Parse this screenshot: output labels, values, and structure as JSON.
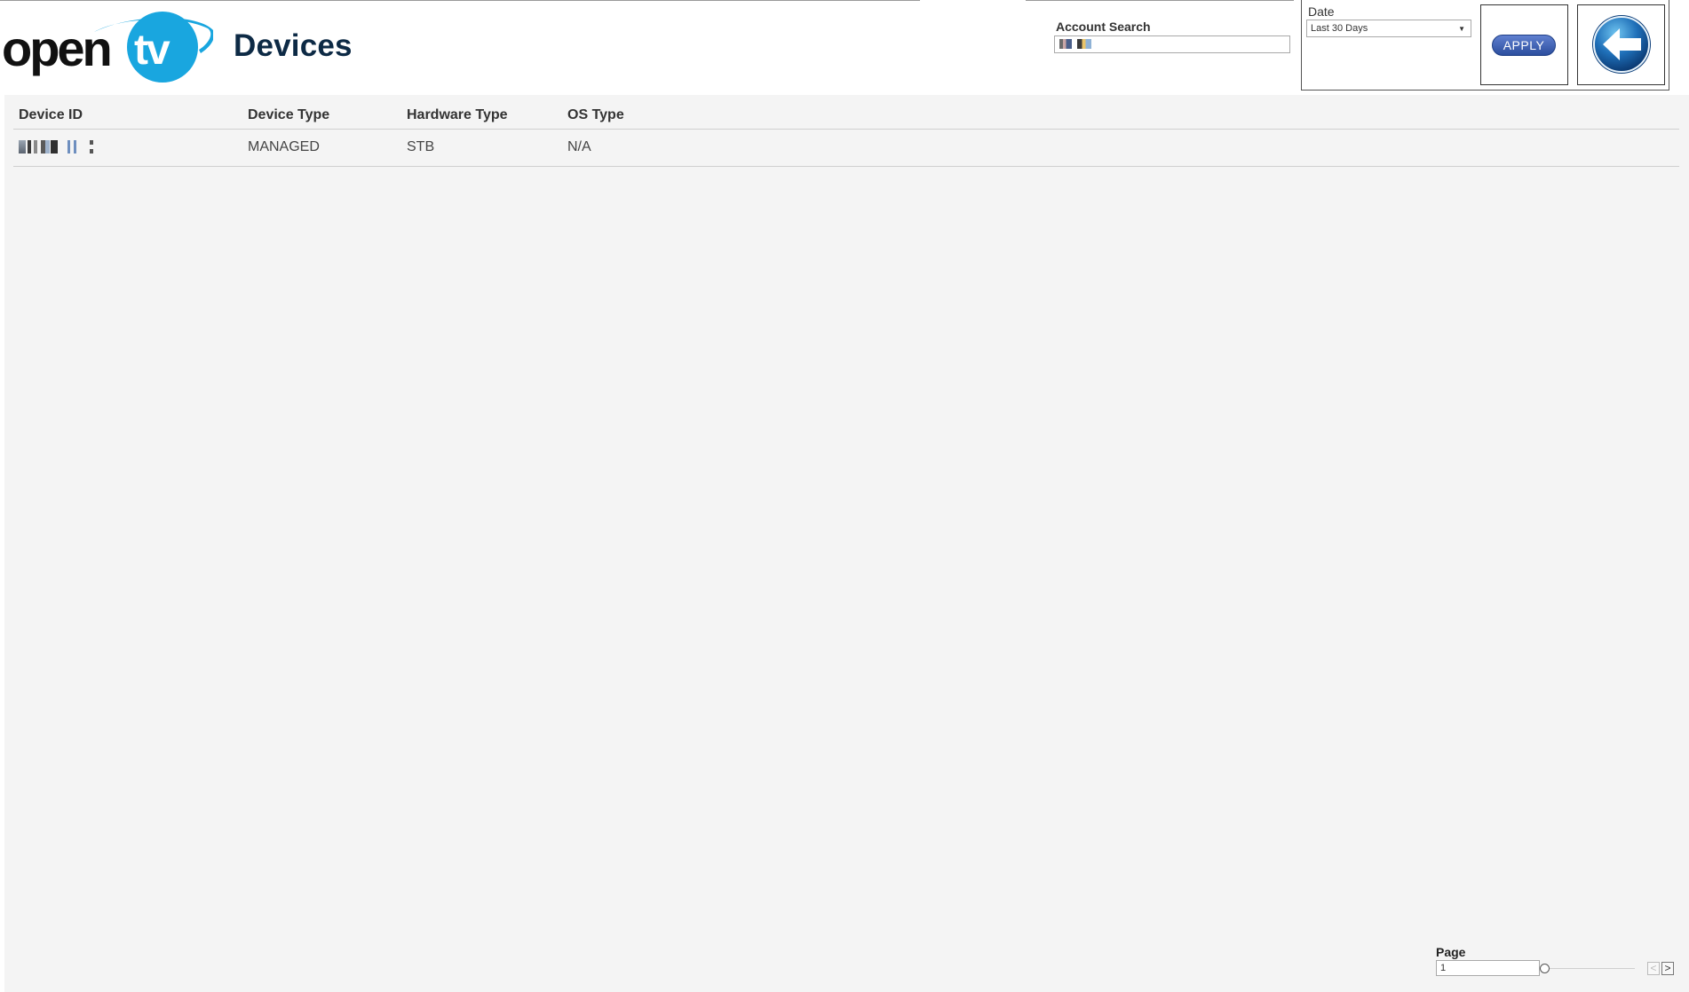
{
  "header": {
    "logo_text": "opentv",
    "page_title": "Devices"
  },
  "account_search": {
    "label": "Account Search",
    "value": ""
  },
  "date_filter": {
    "label": "Date",
    "selected": "Last 30 Days",
    "apply_label": "APPLY"
  },
  "table": {
    "columns": [
      "Device ID",
      "Device Type",
      "Hardware Type",
      "OS Type"
    ],
    "rows": [
      {
        "device_id": "",
        "device_type": "MANAGED",
        "hardware_type": "STB",
        "os_type": "N/A"
      }
    ]
  },
  "pager": {
    "label": "Page",
    "value": "1",
    "prev_glyph": "<",
    "next_glyph": ">"
  },
  "colors": {
    "logo_blue": "#19a6df",
    "title_navy": "#0d2a45",
    "apply_blue": "#2c4e9e",
    "grid_bg": "#f4f4f4"
  },
  "icons": {
    "back": "back-arrow-icon",
    "select": "chevron-down-icon"
  }
}
